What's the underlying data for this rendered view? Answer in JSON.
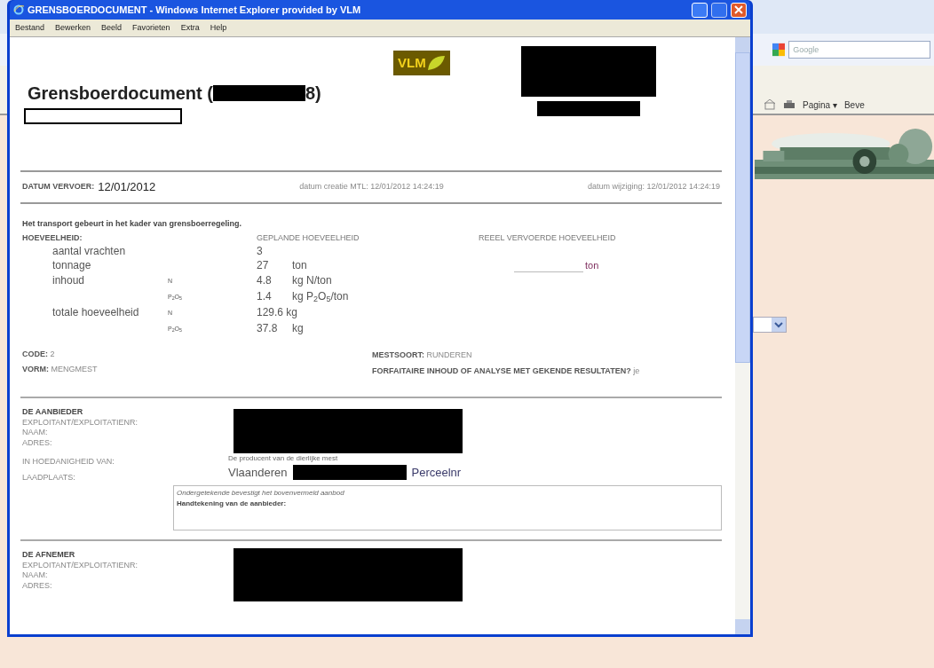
{
  "background_browser": {
    "search": {
      "placeholder": "Google"
    },
    "toolbar": [
      "Pagina ▾",
      "Beve"
    ],
    "banner": {
      "kind": "picture"
    }
  },
  "window": {
    "title": "GRENSBOERDOCUMENT - Windows Internet Explorer provided by VLM"
  },
  "menu": [
    "Bestand",
    "Bewerken",
    "Beeld",
    "Favorieten",
    "Extra",
    "Help"
  ],
  "document": {
    "title": "Grensboerdocument (",
    "title_tail": "8)",
    "logo": "VLM",
    "dates": {
      "vervoer_label": "DATUM VERVOER:",
      "vervoer_value": "12/01/2012",
      "creatie": "datum creatie MTL: 12/01/2012 14:24:19",
      "wijziging": "datum wijziging: 12/01/2012 14:24:19"
    },
    "intro": "Het transport gebeurt in het kader van grensboerregeling.",
    "columns": [
      "HOEVEELHEID:",
      "GEPLANDE HOEVEELHEID",
      "REEEL VERVOERDE HOEVEELHEID"
    ],
    "rows": [
      {
        "label": "aantal vrachten",
        "sub": "",
        "value": "3",
        "unit": "",
        "real_unit": ""
      },
      {
        "label": "tonnage",
        "sub": "",
        "value": "27",
        "unit": "ton",
        "real_unit": "ton"
      },
      {
        "label": "inhoud",
        "sub": "N",
        "value": "4.8",
        "unit": "kg N/ton",
        "real_unit": ""
      },
      {
        "label": "",
        "sub": "P$_{2}$O$_{5}$",
        "value": "1.4",
        "unit": "kg P$_{2}$O$_{5}$/ton",
        "real_unit": ""
      },
      {
        "label": "totale hoeveelheid",
        "sub": "N",
        "value": "129.6 kg",
        "unit": "",
        "real_unit": ""
      },
      {
        "label": "",
        "sub": "P$_{2}$O$_{5}$",
        "value": "37.8",
        "unit": "kg",
        "real_unit": ""
      }
    ],
    "code": {
      "label": "CODE:",
      "value": "2"
    },
    "vorm": {
      "label": "VORM:",
      "value": "MENGMEST"
    },
    "mestsoort": {
      "label": "MESTSOORT:",
      "value": "RUNDEREN"
    },
    "forfaitair": {
      "label": "FORFAITAIRE INHOUD OF ANALYSE MET GEKENDE RESULTATEN?",
      "value": "je"
    },
    "aanbieder": {
      "heading": "DE AANBIEDER",
      "labels": [
        "EXPLOITANT/EXPLOITATIENR:",
        "NAAM:",
        "ADRES:",
        "IN HOEDANIGHEID VAN:",
        "LAADPLAATS:"
      ],
      "hoedanigheid": "De producent van de dierlijke mest",
      "laadplaats": "Vlaanderen",
      "perceel": "Perceelnr",
      "confirm": "Ondergetekende bevestigt het bovenvermeld aanbod",
      "signature": "Handtekening van de aanbieder:"
    },
    "afnemer": {
      "heading": "DE AFNEMER",
      "labels": [
        "EXPLOITANT/EXPLOITATIENR:",
        "NAAM:",
        "ADRES:"
      ]
    }
  }
}
